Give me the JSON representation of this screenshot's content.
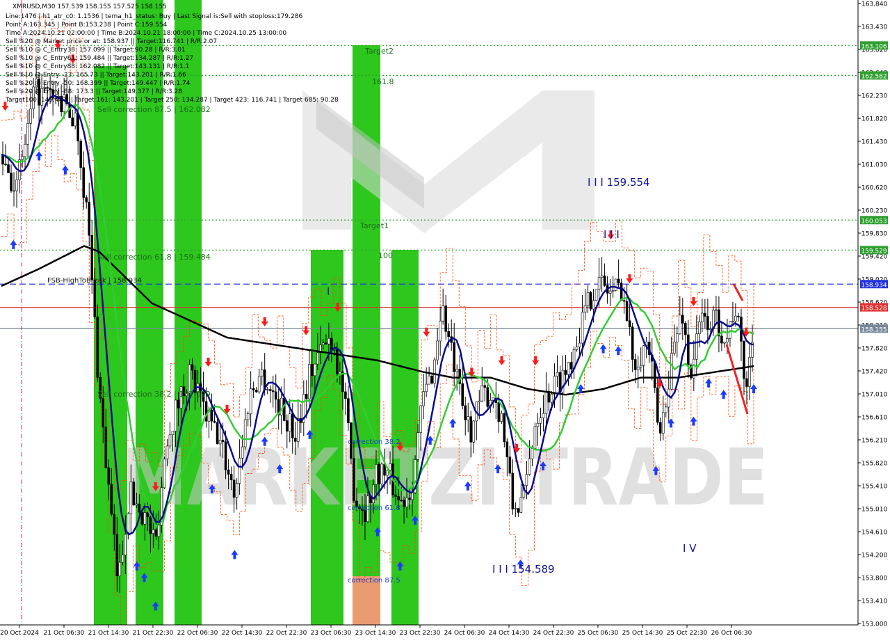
{
  "symbol_header": "XMRUSD,M30  157.539 158.155 157.525 158.155",
  "info_lines": [
    "Line:1476  | h1_atr_c0: 1.1536  | tema_h1_status: Buy  | Last Signal is:Sell with stoploss:179.286",
    "Point A:163.345  | Point B:153.238  | Point C:159.554",
    "Time A:2024.10.21 02:00:00  | Time B:2024.10.21 18:00:00  | Time C:2024.10.25 13:00:00",
    "Sell %20 @ Market price or at: 158.937  || Target:116.741  | R/R:2.07",
    "Sell %10 @ C_Entry38: 157.099  || Target:90.28  | R/R:3.01",
    "Sell %10 @ C_Entry61: 159.484  || Target:134.287  | R/R:1.27",
    "Sell %10 @ C_Entry88: 162.082  || Target:143.131  | R/R:1.1",
    "Sell %10 @ Entry -23: 165.73  || Target:143.201  | R/R:1.66",
    "Sell %20 @ Entry -50: 168.399  || Target:149.447  | R/R:1.74",
    "Sell %20 @ Entry -88: 173.3  || Target:149.377  | R/R:3.28",
    "Target100: 149.447  || Target 161: 143.201  | Target 250: 134.287  | Target 423: 116.741  | Target 685: 90.28"
  ],
  "watermark": "MARKETZI TRADE",
  "chart_data": {
    "type": "candlestick",
    "price_axis": {
      "min": 153.0,
      "max": 163.84,
      "ticks": [
        "163.840",
        "163.430",
        "163.020",
        "162.640",
        "162.230",
        "161.820",
        "161.430",
        "161.030",
        "160.620",
        "160.230",
        "159.830",
        "159.420",
        "159.020",
        "158.620",
        "158.210",
        "157.820",
        "157.420",
        "157.010",
        "156.610",
        "156.210",
        "155.820",
        "155.410",
        "155.010",
        "154.610",
        "154.200",
        "153.800",
        "153.410",
        "153.000"
      ]
    },
    "time_axis_labels": [
      "20 Oct 2024",
      "21 Oct 06:30",
      "21 Oct 14:30",
      "21 Oct 22:30",
      "22 Oct 06:30",
      "22 Oct 14:30",
      "22 Oct 22:30",
      "23 Oct 06:30",
      "23 Oct 14:30",
      "23 Oct 22:30",
      "24 Oct 06:30",
      "24 Oct 14:30",
      "24 Oct 22:30",
      "25 Oct 06:30",
      "25 Oct 14:30",
      "25 Oct 22:30",
      "26 Oct 06:30"
    ],
    "horizontal_levels": [
      {
        "price": 163.106,
        "label": "163.106",
        "color": "#2ea02e",
        "style": "dotted"
      },
      {
        "price": 162.582,
        "label": "162.582",
        "color": "#2ea02e",
        "style": "dotted"
      },
      {
        "price": 160.053,
        "label": "160.053",
        "color": "#2ea02e",
        "style": "dotted"
      },
      {
        "price": 159.529,
        "label": "159.529",
        "color": "#2ea02e",
        "style": "dotted"
      },
      {
        "price": 158.934,
        "label": "158.934",
        "color": "#2233dd",
        "style": "dashed"
      },
      {
        "price": 158.528,
        "label": "158.528",
        "color": "#e03030",
        "style": "solid"
      },
      {
        "price": 158.155,
        "label": "158.155",
        "color": "#778899",
        "style": "solid"
      }
    ],
    "zone_bars": [
      {
        "color": "#22c411"
      },
      {
        "color": "#22c411"
      },
      {
        "color": "#22c411"
      },
      {
        "color": "#22c411"
      },
      {
        "color": "#22c411"
      },
      {
        "color": "#e8966a"
      },
      {
        "color": "#22c411"
      }
    ],
    "annotations": [
      "Sell correction 87.5 | 162.082",
      "Sell correction 61.8 | 159.484",
      "Sell correction 38.2 | 157.099",
      "FSB-HighToBreak | 158.934",
      "Target2",
      "161.8",
      "Target1",
      "100",
      "correction 38.2",
      "correction 61.8",
      "correction 87.5",
      "I I I 159.554",
      "I I I",
      "I I I 154.589",
      "I",
      "I V"
    ],
    "colors": {
      "candle": "#000000",
      "ma_blue": "#0a0a8c",
      "ma_green": "#33cc33",
      "ma_black": "#000000",
      "channel_red": "#ff4400",
      "up_arrow": "#1a3cff",
      "down_arrow": "#ff1a1a"
    }
  }
}
